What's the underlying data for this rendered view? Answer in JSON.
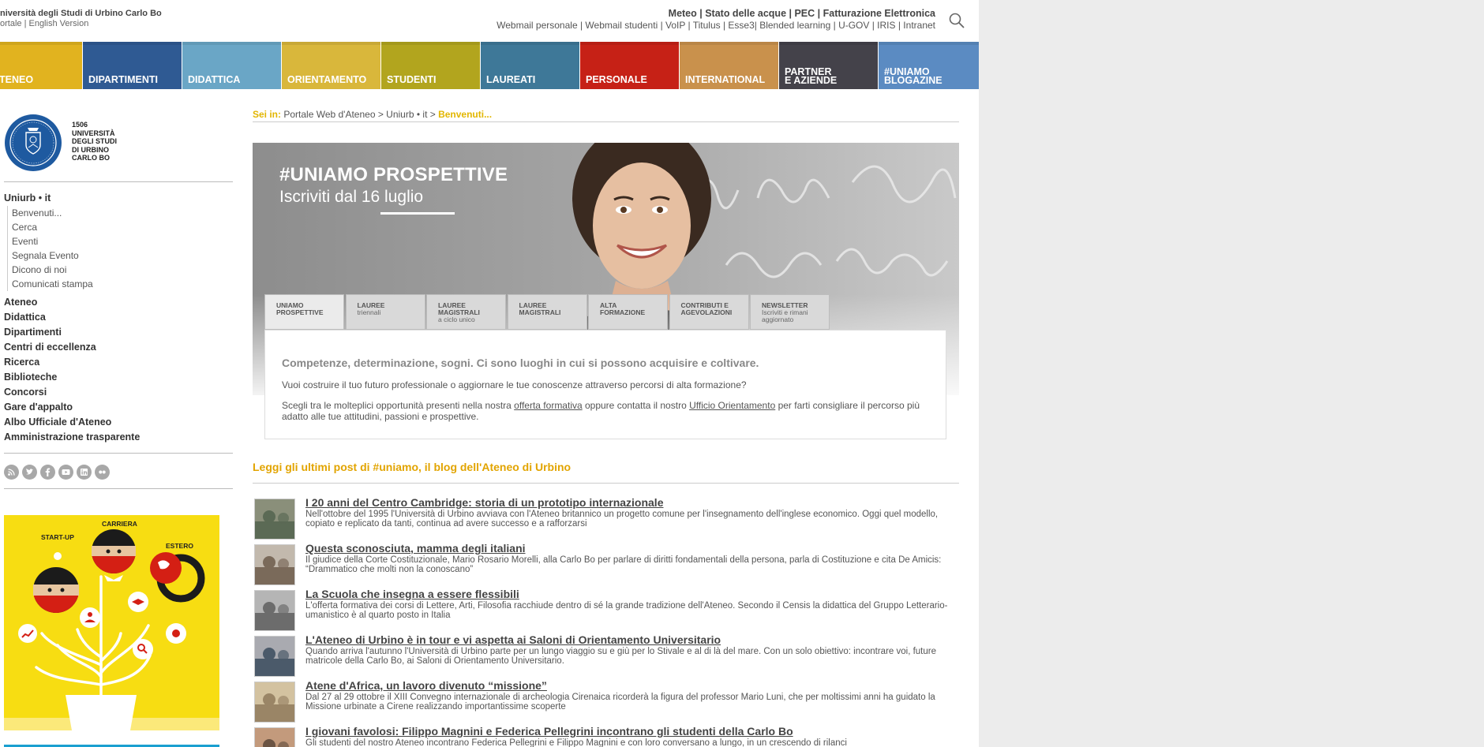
{
  "header": {
    "university_name": "niversità degli Studi di Urbino Carlo Bo",
    "lang_links": "ortale | English Version",
    "top_links_primary": "Meteo | Stato delle acque | PEC | Fatturazione Elettronica",
    "top_links_secondary": "Webmail personale | Webmail studenti | VoIP | Titulus | Esse3| Blended learning | U-GOV | IRIS | Intranet",
    "search_icon": "search-icon"
  },
  "nav": [
    {
      "label": "TENEO",
      "color": "#e1b31f"
    },
    {
      "label": "DIPARTIMENTI",
      "color": "#2f5a93"
    },
    {
      "label": "DIDATTICA",
      "color": "#6aa6c6"
    },
    {
      "label": "ORIENTAMENTO",
      "color": "#d9b73b"
    },
    {
      "label": "STUDENTI",
      "color": "#b2a51e"
    },
    {
      "label": "LAUREATI",
      "color": "#3e7898"
    },
    {
      "label": "PERSONALE",
      "color": "#c62116"
    },
    {
      "label": "INTERNATIONAL",
      "color": "#c9914c"
    },
    {
      "label": "PARTNER",
      "label2": "E AZIENDE",
      "color": "#44424a"
    },
    {
      "label": "#UNIAMO",
      "label2": "BLOGAZINE",
      "color": "#5b8bc2"
    }
  ],
  "logo": {
    "year": "1506",
    "lines": [
      "UNIVERSITÀ",
      "DEGLI STUDI",
      "DI URBINO",
      "CARLO BO"
    ]
  },
  "sidebar": {
    "section_title": "Uniurb • it",
    "sub_items": [
      "Benvenuti...",
      "Cerca",
      "Eventi",
      "Segnala Evento",
      "Dicono di noi",
      "Comunicati stampa"
    ],
    "main_items": [
      "Ateneo",
      "Didattica",
      "Dipartimenti",
      "Centri di eccellenza",
      "Ricerca",
      "Biblioteche",
      "Concorsi",
      "Gare d'appalto",
      "Albo Ufficiale d'Ateneo",
      "Amministrazione trasparente"
    ],
    "social": [
      "rss-icon",
      "twitter-icon",
      "facebook-icon",
      "youtube-icon",
      "linkedin-icon",
      "flickr-icon"
    ],
    "banner_labels": {
      "startup": "START-UP",
      "carriera": "CARRIERA",
      "estero": "ESTERO"
    }
  },
  "breadcrumb": {
    "prefix": "Sei in:",
    "path": "Portale Web d'Ateneo > Uniurb • it > ",
    "current": "Benvenuti..."
  },
  "hero": {
    "title": "#UNIAMO PROSPETTIVE",
    "subtitle": "Iscriviti dal 16 luglio",
    "tabs": [
      {
        "line1": "UNIAMO",
        "line2bold": "PROSPETTIVE",
        "small": ""
      },
      {
        "line1": "LAUREE",
        "line2bold": "",
        "small": "triennali"
      },
      {
        "line1": "LAUREE",
        "line2bold": "MAGISTRALI",
        "small": "a ciclo unico"
      },
      {
        "line1": "LAUREE",
        "line2bold": "MAGISTRALI",
        "small": ""
      },
      {
        "line1": "ALTA",
        "line2bold": "FORMAZIONE",
        "small": ""
      },
      {
        "line1": "CONTRIBUTI E",
        "line2bold": "AGEVOLAZIONI",
        "small": ""
      },
      {
        "line1": "NEWSLETTER",
        "line2bold": "",
        "small": "Iscriviti e rimani aggiornato"
      }
    ],
    "box_heading": "Competenze, determinazione, sogni. Ci sono luoghi in cui si possono acquisire e coltivare.",
    "box_p1": "Vuoi costruire il tuo futuro professionale o aggiornare le tue conoscenze attraverso percorsi di alta formazione?",
    "box_p2_a": "Scegli tra le molteplici opportunità presenti nella nostra ",
    "box_p2_link1": "offerta formativa",
    "box_p2_b": " oppure contatta il nostro ",
    "box_p2_link2": "Ufficio Orientamento",
    "box_p2_c": " per farti consigliare il percorso più adatto alle tue attitudini, passioni e prospettive."
  },
  "blog": {
    "heading": "Leggi gli ultimi post di #uniamo, il blog dell'Ateneo di Urbino",
    "posts": [
      {
        "title": "I 20 anni del Centro Cambridge: storia di un prototipo internazionale",
        "desc": "Nell'ottobre del 1995 l'Università di Urbino avviava con l'Ateneo britannico un progetto comune per l'insegnamento dell'inglese economico. Oggi quel modello, copiato e replicato da tanti, continua ad avere successo e a rafforzarsi",
        "thumb": [
          "#5b6a55",
          "#8a8f7a"
        ]
      },
      {
        "title": "Questa sconosciuta, mamma degli italiani",
        "desc": "Il giudice della Corte Costituzionale, Mario Rosario Morelli, alla Carlo Bo per parlare di diritti fondamentali della persona, parla di Costituzione e cita De Amicis: “Drammatico che molti non la conoscano”",
        "thumb": [
          "#7a6a5a",
          "#c2b9ad"
        ]
      },
      {
        "title": "La Scuola che insegna a essere flessibili",
        "desc": "L'offerta formativa dei corsi di Lettere, Arti, Filosofia racchiude dentro di sé la grande tradizione dell'Ateneo. Secondo il Censis la didattica del Gruppo Letterario-umanistico è al quarto posto in Italia",
        "thumb": [
          "#6c6c6c",
          "#b5b5b5"
        ]
      },
      {
        "title": "L'Ateneo di Urbino è in tour e vi aspetta ai Saloni di Orientamento Universitario",
        "desc": "Quando arriva l'autunno l'Università di Urbino parte per un lungo viaggio su e giù per lo Stivale e al di là del mare. Con un solo obiettivo: incontrare voi, future matricole della Carlo Bo, ai Saloni di Orientamento Universitario.",
        "thumb": [
          "#4b5a6a",
          "#a9aab0"
        ]
      },
      {
        "title": "Atene d'Africa, un lavoro divenuto “missione”",
        "desc": "Dal 27 al 29 ottobre il XIII Convegno internazionale di archeologia Cirenaica ricorderà la figura del professor Mario Luni, che per moltissimi anni ha guidato la Missione urbinate a Cirene realizzando importantissime scoperte",
        "thumb": [
          "#9a8566",
          "#d3c2a0"
        ]
      },
      {
        "title": "I giovani favolosi: Filippo Magnini e Federica Pellegrini incontrano gli studenti della Carlo Bo",
        "desc": "Gli studenti del nostro Ateneo incontrano Federica Pellegrini e Filippo Magnini e con loro conversano a lungo, in un crescendo di rilanci",
        "thumb": [
          "#6b5443",
          "#c39a7c"
        ]
      }
    ]
  }
}
